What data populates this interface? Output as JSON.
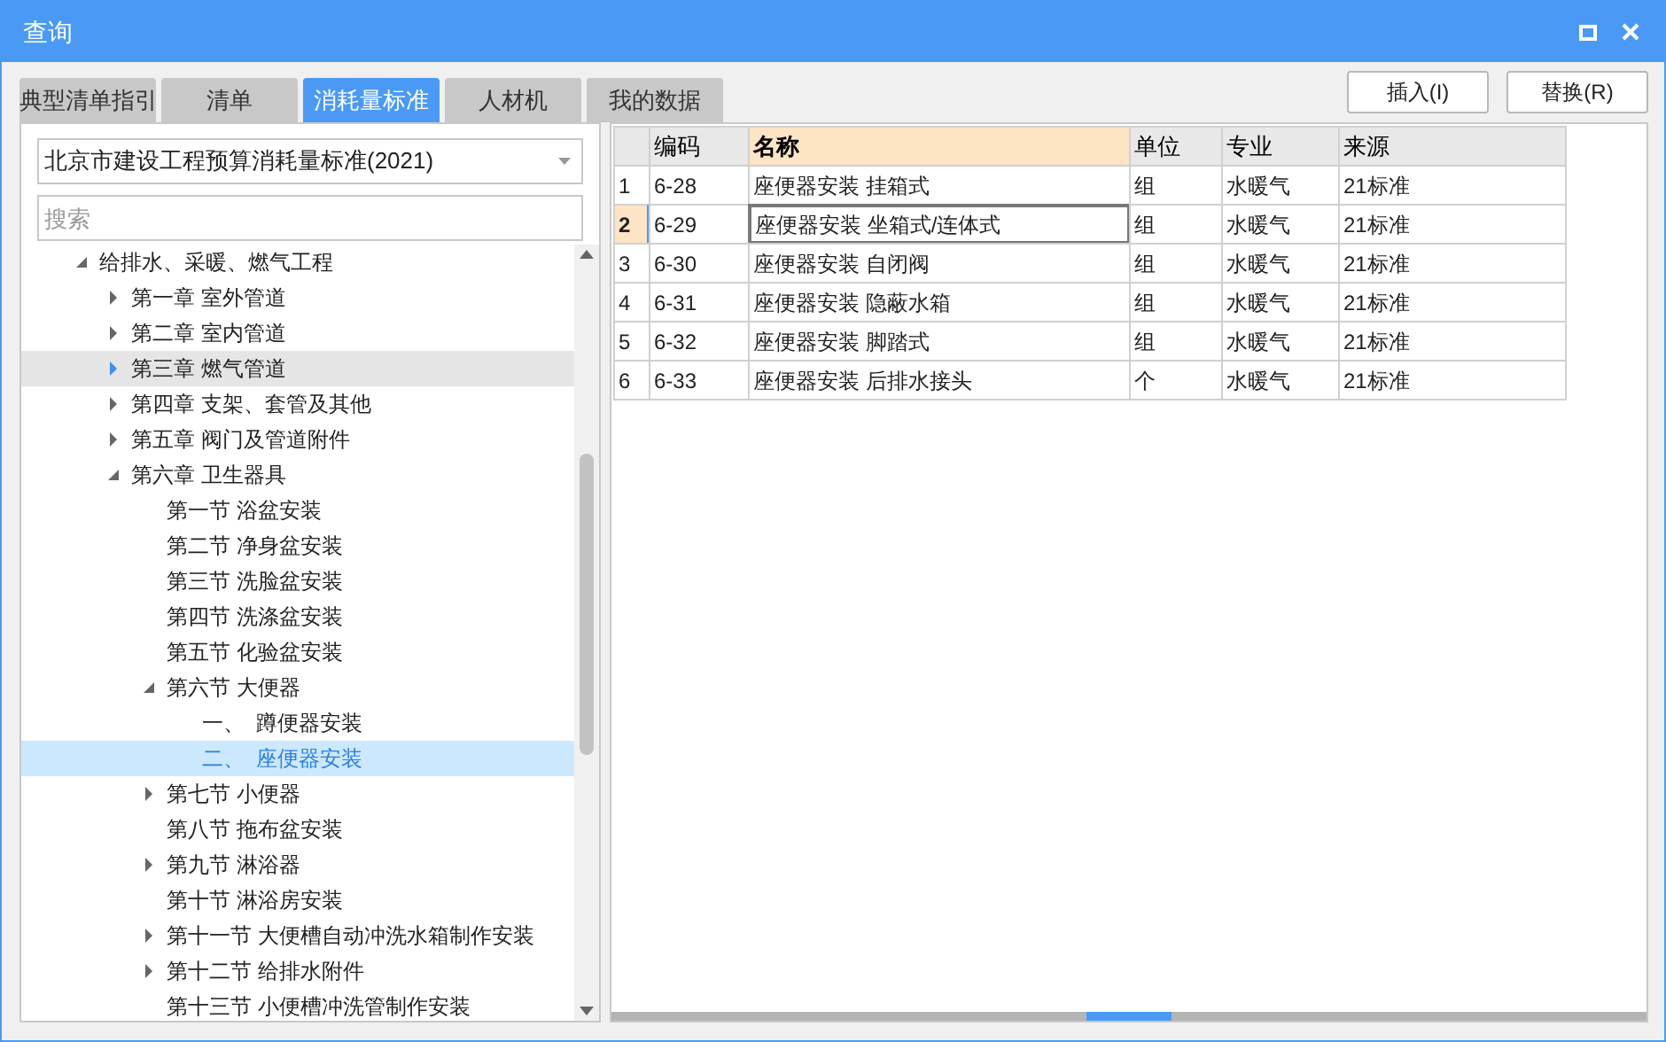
{
  "window": {
    "title": "查询"
  },
  "tabs": [
    {
      "label": "典型清单指引",
      "selected": false
    },
    {
      "label": "清单",
      "selected": false
    },
    {
      "label": "消耗量标准",
      "selected": true
    },
    {
      "label": "人材机",
      "selected": false
    },
    {
      "label": "我的数据",
      "selected": false
    }
  ],
  "buttons": [
    "插入(I)",
    "替换(R)"
  ],
  "standard_select": {
    "value": "北京市建设工程预算消耗量标准(2021)"
  },
  "search": {
    "placeholder": "搜索"
  },
  "tree": [
    {
      "label": "给排水、采暖、燃气工程",
      "kind": "group",
      "expanded": true,
      "selected": false,
      "hovered": false,
      "children": [
        {
          "label": "第一章 室外管道",
          "kind": "group",
          "expanded": false,
          "selected": false,
          "hovered": false
        },
        {
          "label": "第二章 室内管道",
          "kind": "group",
          "expanded": false,
          "selected": false,
          "hovered": false
        },
        {
          "label": "第三章 燃气管道",
          "kind": "group",
          "expanded": false,
          "selected": false,
          "hovered": true
        },
        {
          "label": "第四章 支架、套管及其他",
          "kind": "group",
          "expanded": false,
          "selected": false,
          "hovered": false
        },
        {
          "label": "第五章 阀门及管道附件",
          "kind": "group",
          "expanded": false,
          "selected": false,
          "hovered": false
        },
        {
          "label": "第六章 卫生器具",
          "kind": "group",
          "expanded": true,
          "selected": false,
          "hovered": false,
          "children": [
            {
              "label": "第一节 浴盆安装",
              "kind": "leaf",
              "selected": false,
              "hovered": false
            },
            {
              "label": "第二节 净身盆安装",
              "kind": "leaf",
              "selected": false,
              "hovered": false
            },
            {
              "label": "第三节 洗脸盆安装",
              "kind": "leaf",
              "selected": false,
              "hovered": false
            },
            {
              "label": "第四节 洗涤盆安装",
              "kind": "leaf",
              "selected": false,
              "hovered": false
            },
            {
              "label": "第五节 化验盆安装",
              "kind": "leaf",
              "selected": false,
              "hovered": false
            },
            {
              "label": "第六节 大便器",
              "kind": "group",
              "expanded": true,
              "selected": false,
              "hovered": false,
              "children": [
                {
                  "label": "一、  蹲便器安装",
                  "kind": "leaf",
                  "selected": false,
                  "hovered": false
                },
                {
                  "label": "二、  座便器安装",
                  "kind": "leaf",
                  "selected": true,
                  "hovered": false
                }
              ]
            },
            {
              "label": "第七节 小便器",
              "kind": "group",
              "expanded": false,
              "selected": false,
              "hovered": false
            },
            {
              "label": "第八节 拖布盆安装",
              "kind": "leaf",
              "selected": false,
              "hovered": false
            },
            {
              "label": "第九节 淋浴器",
              "kind": "group",
              "expanded": false,
              "selected": false,
              "hovered": false
            },
            {
              "label": "第十节 淋浴房安装",
              "kind": "leaf",
              "selected": false,
              "hovered": false
            },
            {
              "label": "第十一节 大便槽自动冲洗水箱制作安装",
              "kind": "group",
              "expanded": false,
              "selected": false,
              "hovered": false
            },
            {
              "label": "第十二节 给排水附件",
              "kind": "group",
              "expanded": false,
              "selected": false,
              "hovered": false
            },
            {
              "label": "第十三节 小便槽冲洗管制作安装",
              "kind": "leaf",
              "selected": false,
              "hovered": false
            }
          ]
        }
      ]
    }
  ],
  "table": {
    "columns": [
      {
        "label": "编码",
        "selected": false
      },
      {
        "label": "名称",
        "selected": true
      },
      {
        "label": "单位",
        "selected": false
      },
      {
        "label": "专业",
        "selected": false
      },
      {
        "label": "来源",
        "selected": false
      }
    ],
    "rows": [
      {
        "index": "1",
        "selected": false,
        "cells": [
          "6-28",
          "座便器安装 挂箱式",
          "组",
          "水暖气",
          "21标准"
        ]
      },
      {
        "index": "2",
        "selected": true,
        "cells": [
          "6-29",
          "座便器安装 坐箱式/连体式",
          "组",
          "水暖气",
          "21标准"
        ]
      },
      {
        "index": "3",
        "selected": false,
        "cells": [
          "6-30",
          "座便器安装 自闭阀",
          "组",
          "水暖气",
          "21标准"
        ]
      },
      {
        "index": "4",
        "selected": false,
        "cells": [
          "6-31",
          "座便器安装 隐蔽水箱",
          "组",
          "水暖气",
          "21标准"
        ]
      },
      {
        "index": "5",
        "selected": false,
        "cells": [
          "6-32",
          "座便器安装 脚踏式",
          "组",
          "水暖气",
          "21标准"
        ]
      },
      {
        "index": "6",
        "selected": false,
        "cells": [
          "6-33",
          "座便器安装 后排水接头",
          "个",
          "水暖气",
          "21标准"
        ]
      }
    ]
  }
}
